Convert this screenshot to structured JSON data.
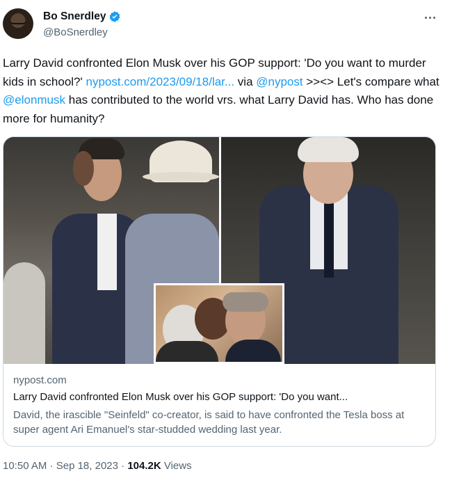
{
  "author": {
    "display_name": "Bo Snerdley",
    "handle": "@BoSnerdley",
    "verified": true
  },
  "tweet": {
    "text_1": "Larry David confronted Elon Musk over his GOP support: 'Do you want to murder kids in school?' ",
    "link": "nypost.com/2023/09/18/lar...",
    "text_2": " via ",
    "mention_1": "@nypost",
    "text_3": " >><> Let's compare what ",
    "mention_2": "@elonmusk",
    "text_4": " has contributed to the world vrs. what Larry David has. Who has done more for humanity?"
  },
  "card": {
    "domain": "nypost.com",
    "title": "Larry David confronted Elon Musk over his GOP support: 'Do you want...",
    "description": "David, the irascible \"Seinfeld\" co-creator, is said to have confronted the Tesla boss at super agent Ari Emanuel's star-studded wedding last year."
  },
  "meta": {
    "time": "10:50 AM",
    "separator": " · ",
    "date": "Sep 18, 2023",
    "views_count": "104.2K",
    "views_label": " Views"
  },
  "icons": {
    "verified": "verified-badge-icon",
    "more": "more-options-icon"
  },
  "colors": {
    "link": "#1d9bf0",
    "secondary_text": "#536471",
    "primary_text": "#0f1419",
    "border": "#cfd9de"
  }
}
